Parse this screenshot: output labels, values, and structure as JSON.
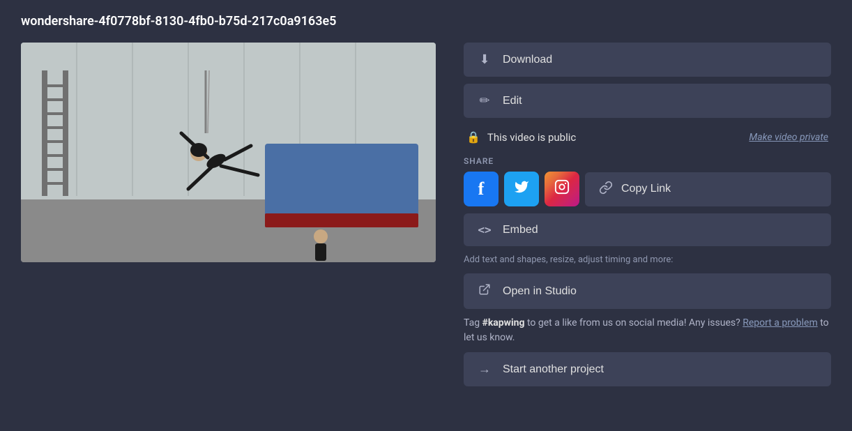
{
  "page": {
    "title": "wondershare-4f0778bf-8130-4fb0-b75d-217c0a9163e5"
  },
  "buttons": {
    "download": "Download",
    "edit": "Edit",
    "embed": "Embed",
    "copy_link": "Copy Link",
    "open_in_studio": "Open in Studio",
    "start_another_project": "Start another project"
  },
  "privacy": {
    "status": "This video is public",
    "make_private": "Make video private"
  },
  "share": {
    "label": "SHARE"
  },
  "studio": {
    "info_text": "Add text and shapes, resize, adjust timing and more:"
  },
  "tag_section": {
    "pre_tag": "Tag ",
    "tag": "#kapwing",
    "post_tag": " to get a like from us on social media! Any issues?",
    "report_link": "Report a problem",
    "post_link": " to let us know."
  },
  "icons": {
    "download": "⬇",
    "edit": "✏",
    "lock": "🔒",
    "embed": "<>",
    "chain": "🔗",
    "external": "↗",
    "arrow": "→"
  }
}
